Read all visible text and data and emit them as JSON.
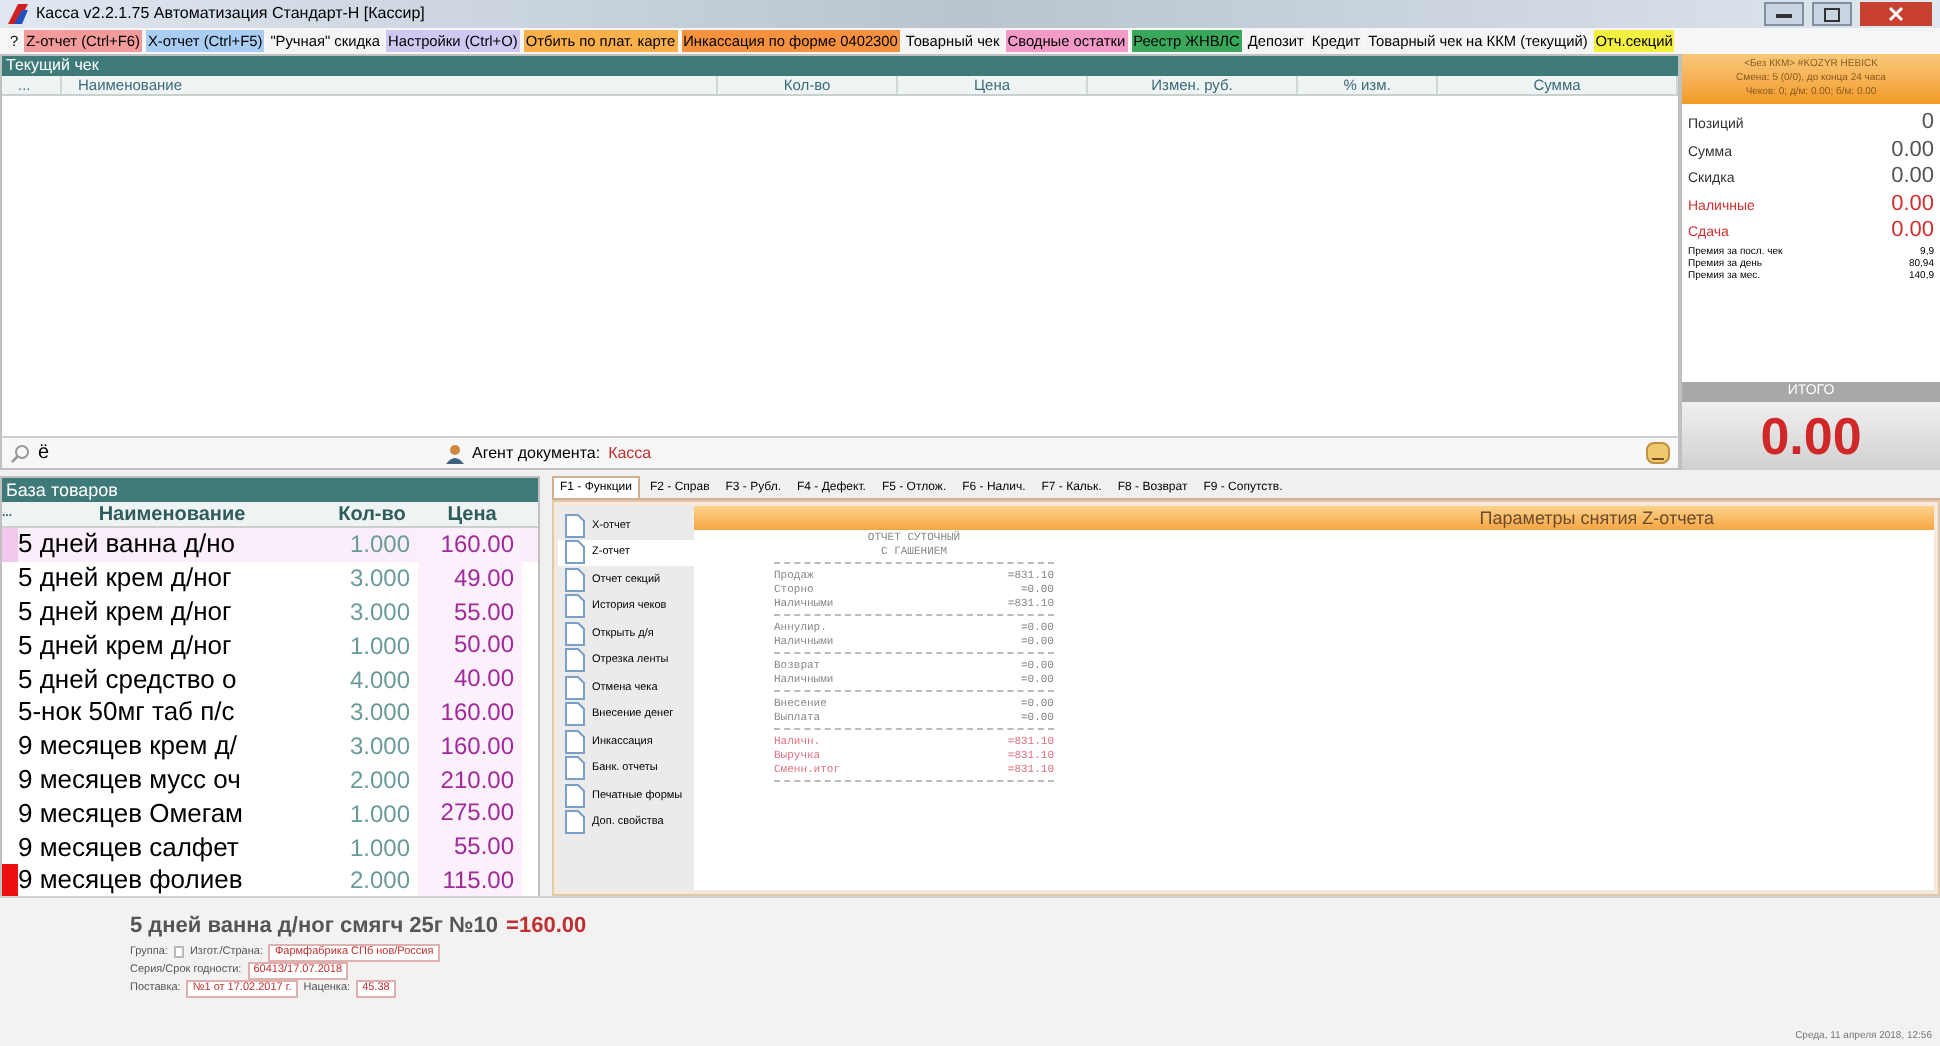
{
  "window": {
    "title": "Касса v2.2.1.75 Автоматизация Стандарт-Н [Кассир]"
  },
  "toolbar": [
    {
      "label": "?",
      "color": "#f4f4f4"
    },
    {
      "label": "Z-отчет (Ctrl+F6)",
      "color": "#f39a9a"
    },
    {
      "label": "X-отчет (Ctrl+F5)",
      "color": "#a9cdf3"
    },
    {
      "label": "\"Ручная\" скидка",
      "color": "#f4f4f4"
    },
    {
      "label": "Настройки (Ctrl+O)",
      "color": "#cfc8f3"
    },
    {
      "label": "Отбить по плат. карте",
      "color": "#f9b04a"
    },
    {
      "label": "Инкассация по форме 0402300",
      "color": "#f6913e"
    },
    {
      "label": "Товарный чек",
      "color": "#f4f4f4"
    },
    {
      "label": "Сводные остатки",
      "color": "#f29ac8"
    },
    {
      "label": "Реестр ЖНВЛС",
      "color": "#3aa85a"
    },
    {
      "label": "Депозит",
      "color": "#f4f4f4"
    },
    {
      "label": "Кредит",
      "color": "#f4f4f4"
    },
    {
      "label": "Товарный чек на ККМ (текущий)",
      "color": "#f4f4f4"
    },
    {
      "label": "Отч.секций",
      "color": "#f4f040"
    }
  ],
  "receipt": {
    "title": "Текущий чек",
    "columns": [
      "...",
      "Наименование",
      "Кол-во",
      "Цена",
      "Измен. руб.",
      "% изм.",
      "Сумма"
    ],
    "search_text": "ё",
    "agent_label": "Агент документа:",
    "agent_value": "Касса"
  },
  "summary": {
    "header": [
      "<Без ККМ> #KOZYR HEBICK",
      "Смена: 5 (0/0), до конца 24 часа",
      "Чеков: 0; д/м: 0.00; б/м: 0.00"
    ],
    "stats": [
      {
        "label": "Позиций",
        "value": "0",
        "highlighted": false
      },
      {
        "label": "Сумма",
        "value": "0.00",
        "highlighted": false
      },
      {
        "label": "Скидка",
        "value": "0.00",
        "highlighted": false
      },
      {
        "label": "Наличные",
        "value": "0.00",
        "highlighted": true
      },
      {
        "label": "Сдача",
        "value": "0.00",
        "highlighted": true
      }
    ],
    "bonuses": [
      {
        "label": "Премия за посл. чек",
        "value": "9,9"
      },
      {
        "label": "Премия за день",
        "value": "80,94"
      },
      {
        "label": "Премия за мес.",
        "value": "140,9"
      }
    ],
    "total_label": "ИТОГО",
    "total": "0.00"
  },
  "goods": {
    "title": "База товаров",
    "columns": [
      "...",
      "Наименование",
      "Кол-во",
      "Цена"
    ],
    "rows": [
      {
        "name": "5 дней ванна д/но",
        "qty": "1.000",
        "price": "160.00",
        "selected": true,
        "flagged": false
      },
      {
        "name": "5 дней крем д/ног",
        "qty": "3.000",
        "price": "49.00",
        "selected": false,
        "flagged": false
      },
      {
        "name": "5 дней крем д/ног",
        "qty": "3.000",
        "price": "55.00",
        "selected": false,
        "flagged": false
      },
      {
        "name": "5 дней крем д/ног",
        "qty": "1.000",
        "price": "50.00",
        "selected": false,
        "flagged": false
      },
      {
        "name": "5 дней средство о",
        "qty": "4.000",
        "price": "40.00",
        "selected": false,
        "flagged": false
      },
      {
        "name": "5-нок 50мг таб п/с",
        "qty": "3.000",
        "price": "160.00",
        "selected": false,
        "flagged": false
      },
      {
        "name": "9 месяцев крем д/",
        "qty": "3.000",
        "price": "160.00",
        "selected": false,
        "flagged": false
      },
      {
        "name": "9 месяцев мусс оч",
        "qty": "2.000",
        "price": "210.00",
        "selected": false,
        "flagged": false
      },
      {
        "name": "9 месяцев Омегам",
        "qty": "1.000",
        "price": "275.00",
        "selected": false,
        "flagged": false
      },
      {
        "name": "9 месяцев салфет",
        "qty": "1.000",
        "price": "55.00",
        "selected": false,
        "flagged": false
      },
      {
        "name": "9 месяцев фолиев",
        "qty": "2.000",
        "price": "115.00",
        "selected": false,
        "flagged": true
      }
    ]
  },
  "function_tabs": [
    {
      "label": "F1 - Функции",
      "selected": true
    },
    {
      "label": "F2 - Справ",
      "selected": false
    },
    {
      "label": "F3 - Рубл.",
      "selected": false
    },
    {
      "label": "F4 - Дефект.",
      "selected": false
    },
    {
      "label": "F5 - Отлож.",
      "selected": false
    },
    {
      "label": "F6 - Налич.",
      "selected": false
    },
    {
      "label": "F7 - Кальк.",
      "selected": false
    },
    {
      "label": "F8 - Возврат",
      "selected": false
    },
    {
      "label": "F9 - Сопутств.",
      "selected": false
    }
  ],
  "functions": [
    {
      "label": "X-отчет",
      "selected": false
    },
    {
      "label": "Z-отчет",
      "selected": true
    },
    {
      "label": "Отчет секций",
      "selected": false
    },
    {
      "label": "История чеков",
      "selected": false
    },
    {
      "label": "Открыть д/я",
      "selected": false
    },
    {
      "label": "Отрезка ленты",
      "selected": false
    },
    {
      "label": "Отмена чека",
      "selected": false
    },
    {
      "label": "Внесение денег",
      "selected": false
    },
    {
      "label": "Инкассация",
      "selected": false
    },
    {
      "label": "Банк. отчеты",
      "selected": false
    },
    {
      "label": "Печатные формы",
      "selected": false
    },
    {
      "label": "Доп. свойства",
      "selected": false
    }
  ],
  "z_report": {
    "title": "Параметры снятия Z-отчета",
    "heading": [
      "ОТЧЕТ СУТОЧНЫЙ",
      "С ГАШЕНИЕМ"
    ],
    "lines": [
      {
        "kind": "rule"
      },
      {
        "kind": "line",
        "label": "Продаж",
        "value": "=831.10"
      },
      {
        "kind": "line",
        "label": "Сторно",
        "value": "=0.00"
      },
      {
        "kind": "line",
        "label": "Наличными",
        "value": "=831.10"
      },
      {
        "kind": "rule"
      },
      {
        "kind": "line",
        "label": "Аннулир.",
        "value": "=0.00"
      },
      {
        "kind": "line",
        "label": "Наличными",
        "value": "=0.00"
      },
      {
        "kind": "rule"
      },
      {
        "kind": "line",
        "label": "Возврат",
        "value": "=0.00"
      },
      {
        "kind": "line",
        "label": "Наличными",
        "value": "=0.00"
      },
      {
        "kind": "rule"
      },
      {
        "kind": "line",
        "label": "Внесение",
        "value": "=0.00"
      },
      {
        "kind": "line",
        "label": "Выплата",
        "value": "=0.00"
      },
      {
        "kind": "rule"
      },
      {
        "kind": "total",
        "label": "Наличн.",
        "value": "=831.10"
      },
      {
        "kind": "total",
        "label": "Выручка",
        "value": "=831.10"
      },
      {
        "kind": "total",
        "label": "Сменн.итог",
        "value": "=831.10"
      },
      {
        "kind": "rule"
      }
    ]
  },
  "product_info": {
    "name": "5 дней ванна д/ног смягч 25г №10",
    "price": "=160.00",
    "rows": [
      [
        {
          "label": "Группа:"
        },
        {
          "label": "Изгот./Страна:",
          "value": "Фармфабрика СПб нов/Россия"
        }
      ],
      [
        {
          "label": "Серия/Срок годности:",
          "value": "60413/17.07.2018"
        }
      ],
      [
        {
          "label": "Поставка:",
          "value": "№1 от 17.02.2017 г."
        },
        {
          "label": "Наценка:",
          "value": "45.38"
        }
      ]
    ]
  },
  "status_bar": {
    "date": "Среда, 11 апреля 2018, 12:56"
  }
}
